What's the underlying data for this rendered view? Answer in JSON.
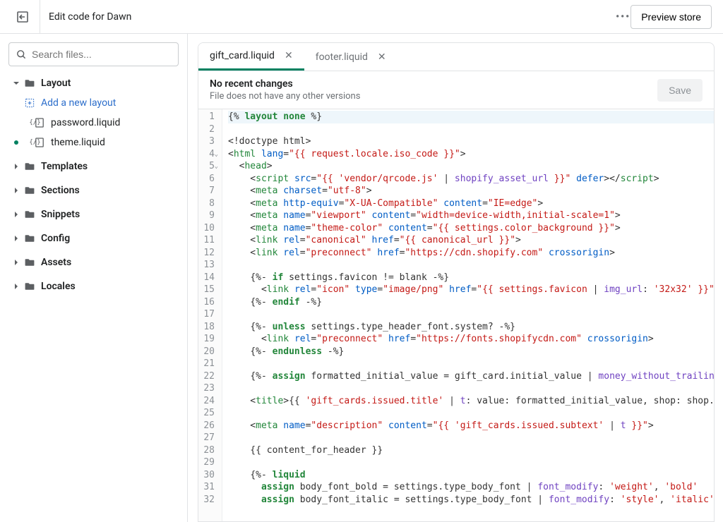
{
  "topbar": {
    "title": "Edit code for Dawn",
    "preview_label": "Preview store"
  },
  "search": {
    "placeholder": "Search files..."
  },
  "sidebar": {
    "sections": [
      {
        "name": "Layout",
        "expanded": true,
        "add_label": "Add a new layout",
        "files": [
          {
            "name": "password.liquid",
            "modified": false
          },
          {
            "name": "theme.liquid",
            "modified": true
          }
        ]
      },
      {
        "name": "Templates",
        "expanded": false
      },
      {
        "name": "Sections",
        "expanded": false
      },
      {
        "name": "Snippets",
        "expanded": false
      },
      {
        "name": "Config",
        "expanded": false
      },
      {
        "name": "Assets",
        "expanded": false
      },
      {
        "name": "Locales",
        "expanded": false
      }
    ]
  },
  "tabs": [
    {
      "label": "gift_card.liquid",
      "active": true
    },
    {
      "label": "footer.liquid",
      "active": false
    }
  ],
  "notice": {
    "title": "No recent changes",
    "subtitle": "File does not have any other versions",
    "save_label": "Save"
  },
  "code_lines": [
    [
      [
        "wrap",
        "{% "
      ],
      [
        "kw",
        "layout"
      ],
      [
        "plain",
        " "
      ],
      [
        "kw",
        "none"
      ],
      [
        "wrap",
        " %}"
      ]
    ],
    [
      [
        "plain",
        ""
      ]
    ],
    [
      [
        "plain",
        "<!doctype html>"
      ]
    ],
    [
      [
        "plain",
        "<"
      ],
      [
        "tag",
        "html"
      ],
      [
        "plain",
        " "
      ],
      [
        "attr",
        "lang"
      ],
      [
        "plain",
        "="
      ],
      [
        "str",
        "\"{{ request.locale.iso_code }}\""
      ],
      [
        "plain",
        ">"
      ]
    ],
    [
      [
        "plain",
        "  <"
      ],
      [
        "tag",
        "head"
      ],
      [
        "plain",
        ">"
      ]
    ],
    [
      [
        "plain",
        "    <"
      ],
      [
        "tag",
        "script"
      ],
      [
        "plain",
        " "
      ],
      [
        "attr",
        "src"
      ],
      [
        "plain",
        "="
      ],
      [
        "str",
        "\"{{ 'vendor/qrcode.js' "
      ],
      [
        "plain",
        "| "
      ],
      [
        "filter",
        "shopify_asset_url"
      ],
      [
        "str",
        " }}\""
      ],
      [
        "plain",
        " "
      ],
      [
        "attr",
        "defer"
      ],
      [
        "plain",
        "></"
      ],
      [
        "tag",
        "script"
      ],
      [
        "plain",
        ">"
      ]
    ],
    [
      [
        "plain",
        "    <"
      ],
      [
        "tag",
        "meta"
      ],
      [
        "plain",
        " "
      ],
      [
        "attr",
        "charset"
      ],
      [
        "plain",
        "="
      ],
      [
        "str",
        "\"utf-8\""
      ],
      [
        "plain",
        ">"
      ]
    ],
    [
      [
        "plain",
        "    <"
      ],
      [
        "tag",
        "meta"
      ],
      [
        "plain",
        " "
      ],
      [
        "attr",
        "http-equiv"
      ],
      [
        "plain",
        "="
      ],
      [
        "str",
        "\"X-UA-Compatible\""
      ],
      [
        "plain",
        " "
      ],
      [
        "attr",
        "content"
      ],
      [
        "plain",
        "="
      ],
      [
        "str",
        "\"IE=edge\""
      ],
      [
        "plain",
        ">"
      ]
    ],
    [
      [
        "plain",
        "    <"
      ],
      [
        "tag",
        "meta"
      ],
      [
        "plain",
        " "
      ],
      [
        "attr",
        "name"
      ],
      [
        "plain",
        "="
      ],
      [
        "str",
        "\"viewport\""
      ],
      [
        "plain",
        " "
      ],
      [
        "attr",
        "content"
      ],
      [
        "plain",
        "="
      ],
      [
        "str",
        "\"width=device-width,initial-scale=1\""
      ],
      [
        "plain",
        ">"
      ]
    ],
    [
      [
        "plain",
        "    <"
      ],
      [
        "tag",
        "meta"
      ],
      [
        "plain",
        " "
      ],
      [
        "attr",
        "name"
      ],
      [
        "plain",
        "="
      ],
      [
        "str",
        "\"theme-color\""
      ],
      [
        "plain",
        " "
      ],
      [
        "attr",
        "content"
      ],
      [
        "plain",
        "="
      ],
      [
        "str",
        "\"{{ settings.color_background }}\""
      ],
      [
        "plain",
        ">"
      ]
    ],
    [
      [
        "plain",
        "    <"
      ],
      [
        "tag",
        "link"
      ],
      [
        "plain",
        " "
      ],
      [
        "attr",
        "rel"
      ],
      [
        "plain",
        "="
      ],
      [
        "str",
        "\"canonical\""
      ],
      [
        "plain",
        " "
      ],
      [
        "attr",
        "href"
      ],
      [
        "plain",
        "="
      ],
      [
        "str",
        "\"{{ canonical_url }}\""
      ],
      [
        "plain",
        ">"
      ]
    ],
    [
      [
        "plain",
        "    <"
      ],
      [
        "tag",
        "link"
      ],
      [
        "plain",
        " "
      ],
      [
        "attr",
        "rel"
      ],
      [
        "plain",
        "="
      ],
      [
        "str",
        "\"preconnect\""
      ],
      [
        "plain",
        " "
      ],
      [
        "attr",
        "href"
      ],
      [
        "plain",
        "="
      ],
      [
        "str",
        "\"https://cdn.shopify.com\""
      ],
      [
        "plain",
        " "
      ],
      [
        "attr",
        "crossorigin"
      ],
      [
        "plain",
        ">"
      ]
    ],
    [
      [
        "plain",
        ""
      ]
    ],
    [
      [
        "plain",
        "    "
      ],
      [
        "wrap",
        "{%- "
      ],
      [
        "kw",
        "if"
      ],
      [
        "plain",
        " settings.favicon != blank "
      ],
      [
        "wrap",
        "-%}"
      ]
    ],
    [
      [
        "plain",
        "      <"
      ],
      [
        "tag",
        "link"
      ],
      [
        "plain",
        " "
      ],
      [
        "attr",
        "rel"
      ],
      [
        "plain",
        "="
      ],
      [
        "str",
        "\"icon\""
      ],
      [
        "plain",
        " "
      ],
      [
        "attr",
        "type"
      ],
      [
        "plain",
        "="
      ],
      [
        "str",
        "\"image/png\""
      ],
      [
        "plain",
        " "
      ],
      [
        "attr",
        "href"
      ],
      [
        "plain",
        "="
      ],
      [
        "str",
        "\"{{ settings.favicon "
      ],
      [
        "plain",
        "| "
      ],
      [
        "filter",
        "img_url"
      ],
      [
        "plain",
        ": "
      ],
      [
        "str",
        "'32x32'"
      ],
      [
        "str",
        " }}\""
      ],
      [
        "plain",
        ">"
      ]
    ],
    [
      [
        "plain",
        "    "
      ],
      [
        "wrap",
        "{%- "
      ],
      [
        "kw",
        "endif"
      ],
      [
        "wrap",
        " -%}"
      ]
    ],
    [
      [
        "plain",
        ""
      ]
    ],
    [
      [
        "plain",
        "    "
      ],
      [
        "wrap",
        "{%- "
      ],
      [
        "kw",
        "unless"
      ],
      [
        "plain",
        " settings.type_header_font.system? "
      ],
      [
        "wrap",
        "-%}"
      ]
    ],
    [
      [
        "plain",
        "      <"
      ],
      [
        "tag",
        "link"
      ],
      [
        "plain",
        " "
      ],
      [
        "attr",
        "rel"
      ],
      [
        "plain",
        "="
      ],
      [
        "str",
        "\"preconnect\""
      ],
      [
        "plain",
        " "
      ],
      [
        "attr",
        "href"
      ],
      [
        "plain",
        "="
      ],
      [
        "str",
        "\"https://fonts.shopifycdn.com\""
      ],
      [
        "plain",
        " "
      ],
      [
        "attr",
        "crossorigin"
      ],
      [
        "plain",
        ">"
      ]
    ],
    [
      [
        "plain",
        "    "
      ],
      [
        "wrap",
        "{%- "
      ],
      [
        "kw",
        "endunless"
      ],
      [
        "wrap",
        " -%}"
      ]
    ],
    [
      [
        "plain",
        ""
      ]
    ],
    [
      [
        "plain",
        "    "
      ],
      [
        "wrap",
        "{%- "
      ],
      [
        "kw",
        "assign"
      ],
      [
        "plain",
        " formatted_initial_value = gift_card.initial_value | "
      ],
      [
        "filter",
        "money_without_trailing_ze"
      ]
    ],
    [
      [
        "plain",
        ""
      ]
    ],
    [
      [
        "plain",
        "    <"
      ],
      [
        "tag",
        "title"
      ],
      [
        "plain",
        ">{{ "
      ],
      [
        "str",
        "'gift_cards.issued.title'"
      ],
      [
        "plain",
        " | "
      ],
      [
        "filter",
        "t"
      ],
      [
        "plain",
        ": value: formatted_initial_value, shop: shop.name"
      ]
    ],
    [
      [
        "plain",
        ""
      ]
    ],
    [
      [
        "plain",
        "    <"
      ],
      [
        "tag",
        "meta"
      ],
      [
        "plain",
        " "
      ],
      [
        "attr",
        "name"
      ],
      [
        "plain",
        "="
      ],
      [
        "str",
        "\"description\""
      ],
      [
        "plain",
        " "
      ],
      [
        "attr",
        "content"
      ],
      [
        "plain",
        "="
      ],
      [
        "str",
        "\"{{ 'gift_cards.issued.subtext' "
      ],
      [
        "plain",
        "| "
      ],
      [
        "filter",
        "t"
      ],
      [
        "str",
        " }}\""
      ],
      [
        "plain",
        ">"
      ]
    ],
    [
      [
        "plain",
        ""
      ]
    ],
    [
      [
        "plain",
        "    {{ content_for_header }}"
      ]
    ],
    [
      [
        "plain",
        ""
      ]
    ],
    [
      [
        "plain",
        "    "
      ],
      [
        "wrap",
        "{%- "
      ],
      [
        "kw",
        "liquid"
      ]
    ],
    [
      [
        "plain",
        "      "
      ],
      [
        "kw",
        "assign"
      ],
      [
        "plain",
        " body_font_bold = settings.type_body_font | "
      ],
      [
        "filter",
        "font_modify"
      ],
      [
        "plain",
        ": "
      ],
      [
        "str",
        "'weight'"
      ],
      [
        "plain",
        ", "
      ],
      [
        "str",
        "'bold'"
      ]
    ],
    [
      [
        "plain",
        "      "
      ],
      [
        "kw",
        "assign"
      ],
      [
        "plain",
        " body_font_italic = settings.type_body_font | "
      ],
      [
        "filter",
        "font_modify"
      ],
      [
        "plain",
        ": "
      ],
      [
        "str",
        "'style'"
      ],
      [
        "plain",
        ", "
      ],
      [
        "str",
        "'italic'"
      ]
    ]
  ],
  "fold_lines": [
    4,
    5
  ]
}
